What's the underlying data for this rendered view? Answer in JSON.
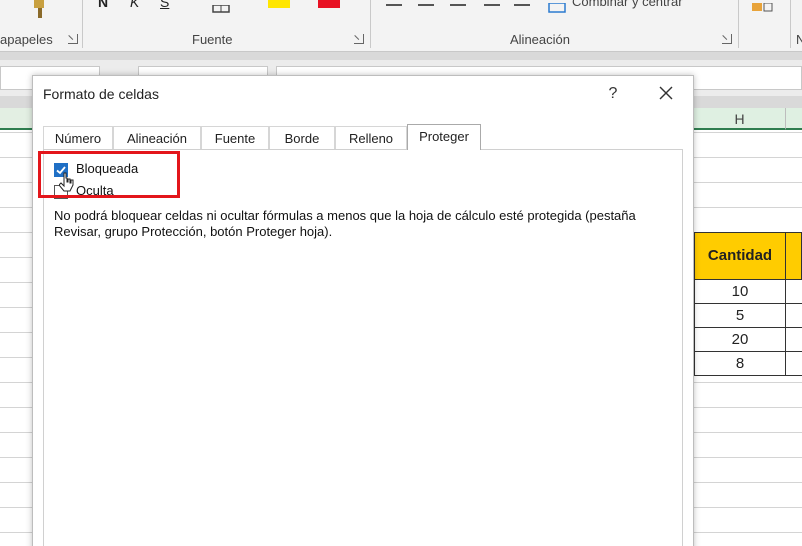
{
  "ribbon": {
    "groups": {
      "clipboard": "apapeles",
      "font": "Fuente",
      "alignment": "Alineación"
    },
    "merge_label": "Combinar y centrar",
    "colors": {
      "highlight": "#ffe600",
      "font_color": "#e81123"
    }
  },
  "sheet": {
    "column_h": "H",
    "header_cell": "Cantidad",
    "values": [
      "10",
      "5",
      "20",
      "8"
    ],
    "colors": {
      "header_fill": "#ffcc00",
      "column_header_selected": "#dff0e2"
    }
  },
  "dialog": {
    "title": "Formato de celdas",
    "help_label": "?",
    "tabs": [
      "Número",
      "Alineación",
      "Fuente",
      "Borde",
      "Relleno",
      "Proteger"
    ],
    "active_tab": "Proteger",
    "protection": {
      "locked_label": "Bloqueada",
      "locked_checked": true,
      "hidden_label": "Oculta",
      "hidden_checked": false,
      "info_text": "No podrá bloquear celdas ni ocultar fórmulas a menos que la hoja de cálculo esté protegida (pestaña Revisar, grupo Protección, botón Proteger hoja)."
    },
    "colors": {
      "highlight_box": "#e3161b",
      "checkbox_accent": "#1f6fc5"
    },
    "icons": [
      "close-icon",
      "check-icon",
      "mouse-pointer-icon"
    ]
  }
}
